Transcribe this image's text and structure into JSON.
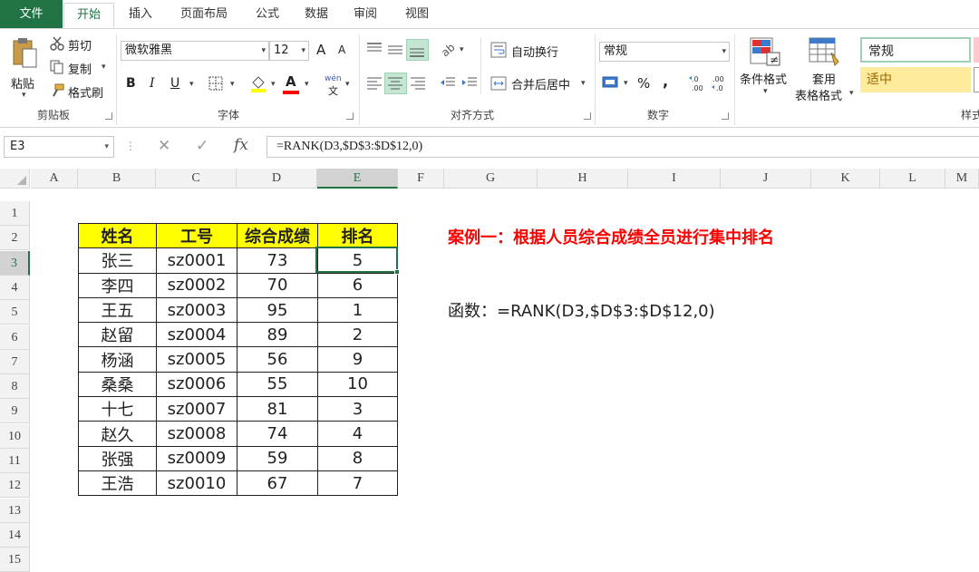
{
  "tabs": {
    "file": "文件",
    "home": "开始",
    "insert": "插入",
    "layout": "页面布局",
    "formulas": "公式",
    "data": "数据",
    "review": "审阅",
    "view": "视图"
  },
  "ribbon": {
    "clipboard": {
      "paste": "粘贴",
      "cut": "剪切",
      "copy": "复制",
      "format_painter": "格式刷",
      "label": "剪贴板"
    },
    "font": {
      "name": "微软雅黑",
      "size": "12",
      "grow": "A",
      "shrink": "A",
      "bold": "B",
      "italic": "I",
      "underline": "U",
      "font_color": "A",
      "phonetic": "wén",
      "label": "字体"
    },
    "alignment": {
      "wrap_text": "自动换行",
      "merge_center": "合并后居中",
      "label": "对齐方式"
    },
    "number": {
      "format": "常规",
      "percent": "%",
      "comma": ",",
      "inc_decimal": "←.0\n.00",
      "dec_decimal": ".00\n→.0",
      "label": "数字"
    },
    "styles": {
      "conditional_format": "条件格式",
      "format_as_table_line1": "套用",
      "format_as_table_line2": "表格格式",
      "normal": "常规",
      "neutral": "适中",
      "label": "样式"
    }
  },
  "formula_bar": {
    "name_box": "E3",
    "cancel": "✕",
    "enter": "✓",
    "fx": "fx",
    "formula": "=RANK(D3,$D$3:$D$12,0)"
  },
  "columns": [
    "A",
    "B",
    "C",
    "D",
    "E",
    "F",
    "G",
    "H",
    "I",
    "J",
    "K",
    "L",
    "M"
  ],
  "rows": [
    "1",
    "2",
    "3",
    "4",
    "5",
    "6",
    "7",
    "8",
    "9",
    "10",
    "11",
    "12",
    "13",
    "14",
    "15"
  ],
  "table": {
    "headers": [
      "姓名",
      "工号",
      "综合成绩",
      "排名"
    ],
    "rows": [
      [
        "张三",
        "sz0001",
        "73",
        "5"
      ],
      [
        "李四",
        "sz0002",
        "70",
        "6"
      ],
      [
        "王五",
        "sz0003",
        "95",
        "1"
      ],
      [
        "赵留",
        "sz0004",
        "89",
        "2"
      ],
      [
        "杨涵",
        "sz0005",
        "56",
        "9"
      ],
      [
        "桑桑",
        "sz0006",
        "55",
        "10"
      ],
      [
        "十七",
        "sz0007",
        "81",
        "3"
      ],
      [
        "赵久",
        "sz0008",
        "74",
        "4"
      ],
      [
        "张强",
        "sz0009",
        "59",
        "8"
      ],
      [
        "王浩",
        "sz0010",
        "67",
        "7"
      ]
    ]
  },
  "annotations": {
    "case_title": "案例一：根据人员综合成绩全员进行集中排名",
    "function_text": "函数：=RANK(D3,$D$3:$D$12,0)"
  },
  "colors": {
    "excel_green": "#217346",
    "header_fill": "#ffff00",
    "case_title": "#ff0000"
  }
}
